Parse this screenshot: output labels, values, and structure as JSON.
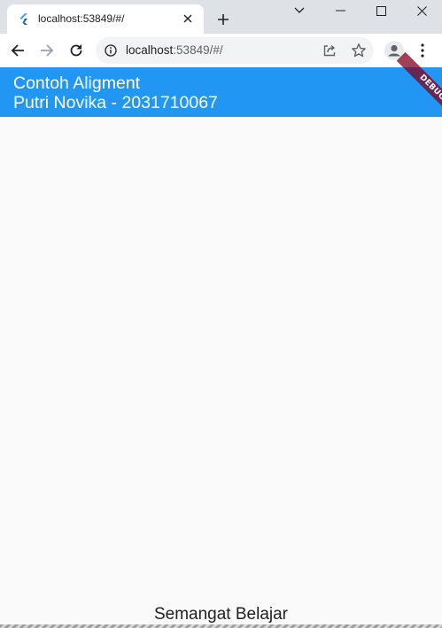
{
  "browser": {
    "tab_title": "localhost:53849/#/",
    "url_host": "localhost",
    "url_rest": ":53849/#/"
  },
  "app": {
    "title": "Contoh Aligment\nPutri Novika - 2031710067",
    "debug_banner": "DEBUG",
    "body_text": "Semangat Belajar",
    "appbar_color": "#2196f3"
  }
}
